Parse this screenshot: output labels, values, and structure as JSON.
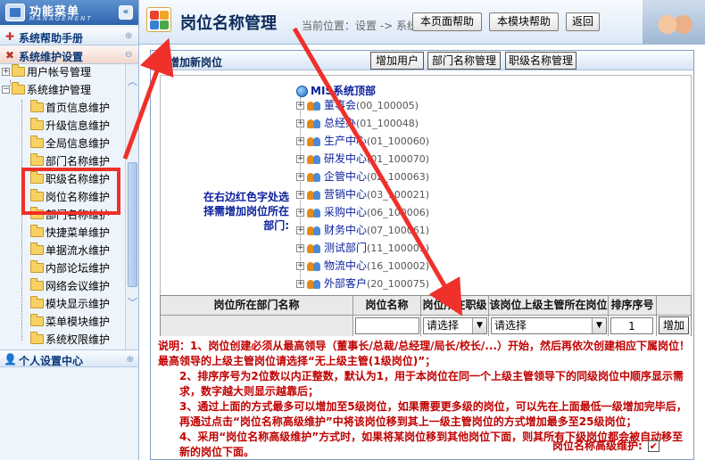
{
  "sidebar": {
    "title": "功能菜单",
    "subtitle": "MANAGEMENT",
    "sections": [
      {
        "label": "系统帮助手册"
      },
      {
        "label": "系统维护设置"
      }
    ],
    "tree": [
      {
        "label": "用户帐号管理",
        "level": 0,
        "toggle": "+"
      },
      {
        "label": "系统维护管理",
        "level": 0,
        "toggle": "-"
      },
      {
        "label": "首页信息维护",
        "level": 1
      },
      {
        "label": "升级信息维护",
        "level": 1
      },
      {
        "label": "全局信息维护",
        "level": 1
      },
      {
        "label": "部门名称维护",
        "level": 1
      },
      {
        "label": "职级名称维护",
        "level": 1
      },
      {
        "label": "岗位名称维护",
        "level": 1
      },
      {
        "label": "部门名称维护",
        "level": 1
      },
      {
        "label": "快捷菜单维护",
        "level": 1
      },
      {
        "label": "单据流水维护",
        "level": 1
      },
      {
        "label": "内部论坛维护",
        "level": 1
      },
      {
        "label": "网络会议维护",
        "level": 1
      },
      {
        "label": "模块显示维护",
        "level": 1
      },
      {
        "label": "菜单模块维护",
        "level": 1
      },
      {
        "label": "系统权限维护",
        "level": 1
      }
    ],
    "footer": "个人设置中心"
  },
  "header": {
    "title": "岗位名称管理",
    "breadcrumb": "当前位置：设置 -> 系统维护",
    "buttons": [
      "本页面帮助",
      "本模块帮助",
      "返回"
    ]
  },
  "panel": {
    "title": "增加新岗位",
    "buttons": [
      "增加用户",
      "部门名称管理",
      "职级名称管理"
    ],
    "hint": "在右边红色字处选择需增加岗位所在部门:",
    "org_root": "MIS系统顶部",
    "org_items": [
      {
        "name": "董事会",
        "code": "(00_100005)"
      },
      {
        "name": "总经办",
        "code": "(01_100048)"
      },
      {
        "name": "生产中心",
        "code": "(01_100060)"
      },
      {
        "name": "研发中心",
        "code": "(01_100070)"
      },
      {
        "name": "企管中心",
        "code": "(02_100063)"
      },
      {
        "name": "营销中心",
        "code": "(03_100021)"
      },
      {
        "name": "采购中心",
        "code": "(06_100006)"
      },
      {
        "name": "财务中心",
        "code": "(07_100061)"
      },
      {
        "name": "测试部门",
        "code": "(11_100001)"
      },
      {
        "name": "物流中心",
        "code": "(16_100002)"
      },
      {
        "name": "外部客户",
        "code": "(20_100075)"
      }
    ]
  },
  "form": {
    "headers": [
      "岗位所在部门名称",
      "岗位名称",
      "岗位所在职级",
      "该岗位上级主管所在岗位",
      "排序序号"
    ],
    "department_value": "",
    "position_value": "",
    "rank_select": "请选择",
    "superior_select": "请选择",
    "sort_value": "1",
    "add_button": "增加"
  },
  "notes": [
    "说明：1、岗位创建必须从最高领导（董事长/总裁/总经理/局长/校长/...）开始，然后再依次创建相应下属岗位！最高领导的上级主管岗位请选择“无上级主管(1级岗位)”；",
    "2、排序序号为2位数以内正整数，默认为1，用于本岗位在同一个上级主管领导下的同级岗位中顺序显示需求，数字越大则显示越靠后；",
    "3、通过上面的方式最多可以增加至5级岗位，如果需要更多级的岗位，可以先在上面最低一级增加完毕后，再通过点击“岗位名称高级维护”中将该岗位移到其上一级主管岗位的方式增加最多至25级岗位；",
    "4、采用“岗位名称高级维护”方式时，如果将某岗位移到其他岗位下面，则其所有下级岗位都会被自动移至新的岗位下面。"
  ],
  "advanced": {
    "label": "岗位名称高级维护:",
    "checked": true
  }
}
